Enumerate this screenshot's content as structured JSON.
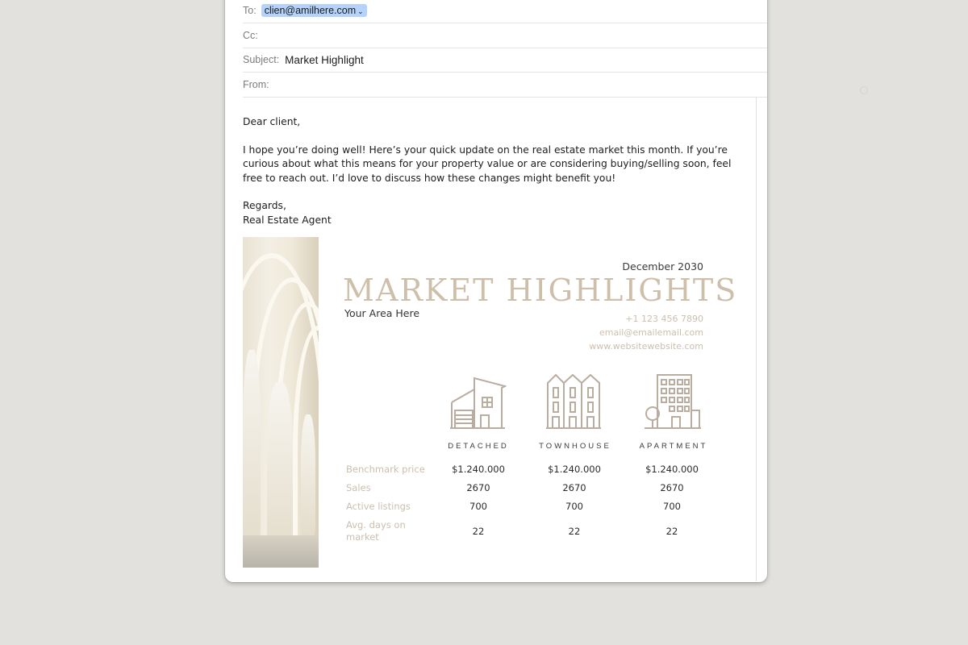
{
  "header": {
    "to_label": "To:",
    "to_value": "clien@amilhere.com",
    "cc_label": "Cc:",
    "subject_label": "Subject:",
    "subject_value": "Market Highlight",
    "from_label": "From:"
  },
  "body": {
    "greeting": "Dear client,",
    "paragraph": "I hope you’re doing well! Here’s your quick update on the real estate market this month. If you’re curious about what this means for your property value or are considering buying/selling soon, feel free to reach out. I’d love to discuss how these changes might benefit you!",
    "signoff": "Regards,",
    "signature": "Real Estate Agent"
  },
  "flyer": {
    "date": "December  2030",
    "title": "MARKET HIGHLIGHTS",
    "area": "Your Area Here",
    "phone": "+1 123 456 7890",
    "email": "email@emailemail.com",
    "website": "www.websitewebsite.com",
    "accent_color": "#cbbfae",
    "columns": [
      {
        "label": "DETACHED",
        "icon": "detached-house-icon"
      },
      {
        "label": "TOWNHOUSE",
        "icon": "townhouse-icon"
      },
      {
        "label": "APARTMENT",
        "icon": "apartment-building-icon"
      }
    ],
    "rows": [
      {
        "label": "Benchmark price",
        "values": [
          "$1.240.000",
          "$1.240.000",
          "$1.240.000"
        ]
      },
      {
        "label": "Sales",
        "values": [
          "2670",
          "2670",
          "2670"
        ]
      },
      {
        "label": "Active listings",
        "values": [
          "700",
          "700",
          "700"
        ]
      },
      {
        "label": "Avg. days on market",
        "label_lines": [
          "Avg. days on",
          "market"
        ],
        "values": [
          "22",
          "22",
          "22"
        ]
      }
    ]
  }
}
